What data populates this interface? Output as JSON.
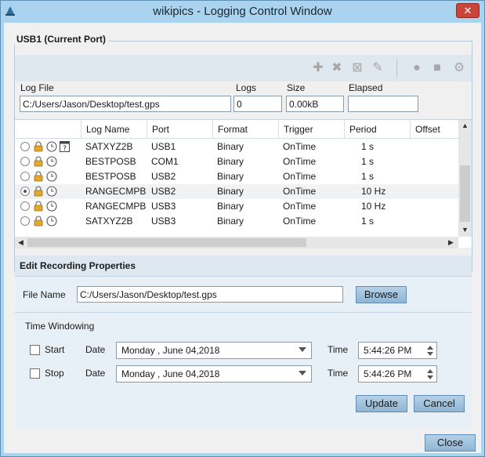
{
  "window": {
    "title": "wikipics - Logging Control Window",
    "close_glyph": "✕"
  },
  "port_group": {
    "legend": "USB1 (Current Port)"
  },
  "toolbar": {
    "icons": [
      "add-icon",
      "delete-icon",
      "delete-all-icon",
      "edit-icon",
      "record-icon",
      "stop-icon",
      "settings-icon"
    ],
    "glyphs": {
      "add": "✚",
      "delete": "✖",
      "delete_all": "⊠",
      "edit": "✎",
      "record": "●",
      "stop": "■",
      "settings": "⚙"
    },
    "disabled_color": "#a7a7a7"
  },
  "summary": {
    "log_file_label": "Log File",
    "log_file_value": "C:/Users/Jason/Desktop/test.gps",
    "logs_label": "Logs",
    "logs_value": "0",
    "size_label": "Size",
    "size_value": "0.00kB",
    "elapsed_label": "Elapsed",
    "elapsed_value": ""
  },
  "table": {
    "columns": [
      "Log Name",
      "Port",
      "Format",
      "Trigger",
      "Period",
      "Offset"
    ],
    "rows": [
      {
        "log_name": "SATXYZ2B",
        "port": "USB1",
        "format": "Binary",
        "trigger": "OnTime",
        "period": "1 s",
        "selected": false,
        "has_query": true
      },
      {
        "log_name": "BESTPOSB",
        "port": "COM1",
        "format": "Binary",
        "trigger": "OnTime",
        "period": "1 s",
        "selected": false,
        "has_query": false
      },
      {
        "log_name": "BESTPOSB",
        "port": "USB2",
        "format": "Binary",
        "trigger": "OnTime",
        "period": "1 s",
        "selected": false,
        "has_query": false
      },
      {
        "log_name": "RANGECMPB",
        "port": "USB2",
        "format": "Binary",
        "trigger": "OnTime",
        "period": "10 Hz",
        "selected": true,
        "has_query": false
      },
      {
        "log_name": "RANGECMPB",
        "port": "USB3",
        "format": "Binary",
        "trigger": "OnTime",
        "period": "10 Hz",
        "selected": false,
        "has_query": false
      },
      {
        "log_name": "SATXYZ2B",
        "port": "USB3",
        "format": "Binary",
        "trigger": "OnTime",
        "period": "1 s",
        "selected": false,
        "has_query": false
      }
    ],
    "scroll_up": "▲",
    "scroll_down": "▼",
    "scroll_left": "◀",
    "scroll_right": "▶"
  },
  "recording": {
    "header": "Edit Recording Properties",
    "file_name_label": "File Name",
    "file_name_value": "C:/Users/Jason/Desktop/test.gps",
    "browse_label": "Browse",
    "time_windowing_label": "Time Windowing",
    "start": {
      "label": "Start",
      "checked": false,
      "date_label": "Date",
      "date_value": "Monday , June 04,2018",
      "time_label": "Time",
      "time_value": "5:44:26 PM"
    },
    "stop": {
      "label": "Stop",
      "checked": false,
      "date_label": "Date",
      "date_value": "Monday , June 04,2018",
      "time_label": "Time",
      "time_value": "5:44:26 PM"
    },
    "update_label": "Update",
    "cancel_label": "Cancel"
  },
  "footer": {
    "close_label": "Close"
  },
  "colors": {
    "accent": "#a9d3ef",
    "button": "#9fc2de",
    "lock": "#e2a92f"
  }
}
